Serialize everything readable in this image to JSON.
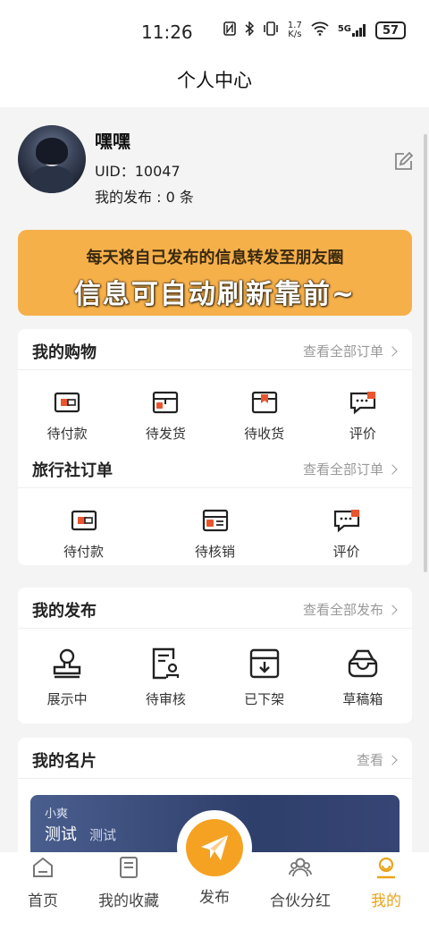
{
  "status": {
    "time": "11:26",
    "speed_top": "1.7",
    "speed_bottom": "K/s",
    "net": "5G",
    "battery": "57"
  },
  "title": "个人中心",
  "profile": {
    "name": "嘿嘿",
    "uid": "UID：10047",
    "published": "我的发布 : 0 条"
  },
  "banner": {
    "line1": "每天将自己发布的信息转发至朋友圈",
    "line2": "信息可自动刷新靠前~"
  },
  "shopping": {
    "title": "我的购物",
    "more": "查看全部订单",
    "items": [
      {
        "label": "待付款",
        "icon": "wallet-icon"
      },
      {
        "label": "待发货",
        "icon": "package-icon"
      },
      {
        "label": "待收货",
        "icon": "box-icon"
      },
      {
        "label": "评价",
        "icon": "comment-icon"
      }
    ]
  },
  "travel": {
    "title": "旅行社订单",
    "more": "查看全部订单",
    "items": [
      {
        "label": "待付款",
        "icon": "wallet-icon"
      },
      {
        "label": "待核销",
        "icon": "ticket-icon"
      },
      {
        "label": "评价",
        "icon": "comment-icon"
      }
    ]
  },
  "publish": {
    "title": "我的发布",
    "more": "查看全部发布",
    "items": [
      {
        "label": "展示中",
        "icon": "stamp-icon"
      },
      {
        "label": "待审核",
        "icon": "review-icon"
      },
      {
        "label": "已下架",
        "icon": "archive-icon"
      },
      {
        "label": "草稿箱",
        "icon": "draft-icon"
      }
    ]
  },
  "namecard": {
    "title": "我的名片",
    "more": "查看",
    "small": "小爽",
    "name": "测试",
    "sub": "测试"
  },
  "tabs": [
    {
      "label": "首页",
      "icon": "home-icon"
    },
    {
      "label": "我的收藏",
      "icon": "bookmark-icon"
    },
    {
      "label": "发布",
      "icon": "paper-plane-icon"
    },
    {
      "label": "合伙分红",
      "icon": "partners-icon"
    },
    {
      "label": "我的",
      "icon": "user-icon"
    }
  ],
  "colors": {
    "accent": "#f5a222",
    "banner": "#f6b04a",
    "active_tab": "#e9a41a",
    "icon_red": "#e8552e"
  }
}
